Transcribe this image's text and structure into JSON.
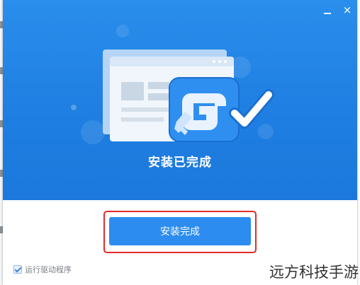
{
  "window": {
    "minimize_label": "",
    "close_label": "×"
  },
  "hero": {
    "title": "安装已完成"
  },
  "actions": {
    "finish_label": "安装完成"
  },
  "options": {
    "run_driver_program_label": "运行驱动程序",
    "run_driver_program_checked": true
  },
  "watermark": {
    "text": "远方科技手游"
  },
  "colors": {
    "hero_blue": "#1f7fe2",
    "button_blue": "#2c8cf0",
    "highlight_red": "#e02c2c"
  }
}
